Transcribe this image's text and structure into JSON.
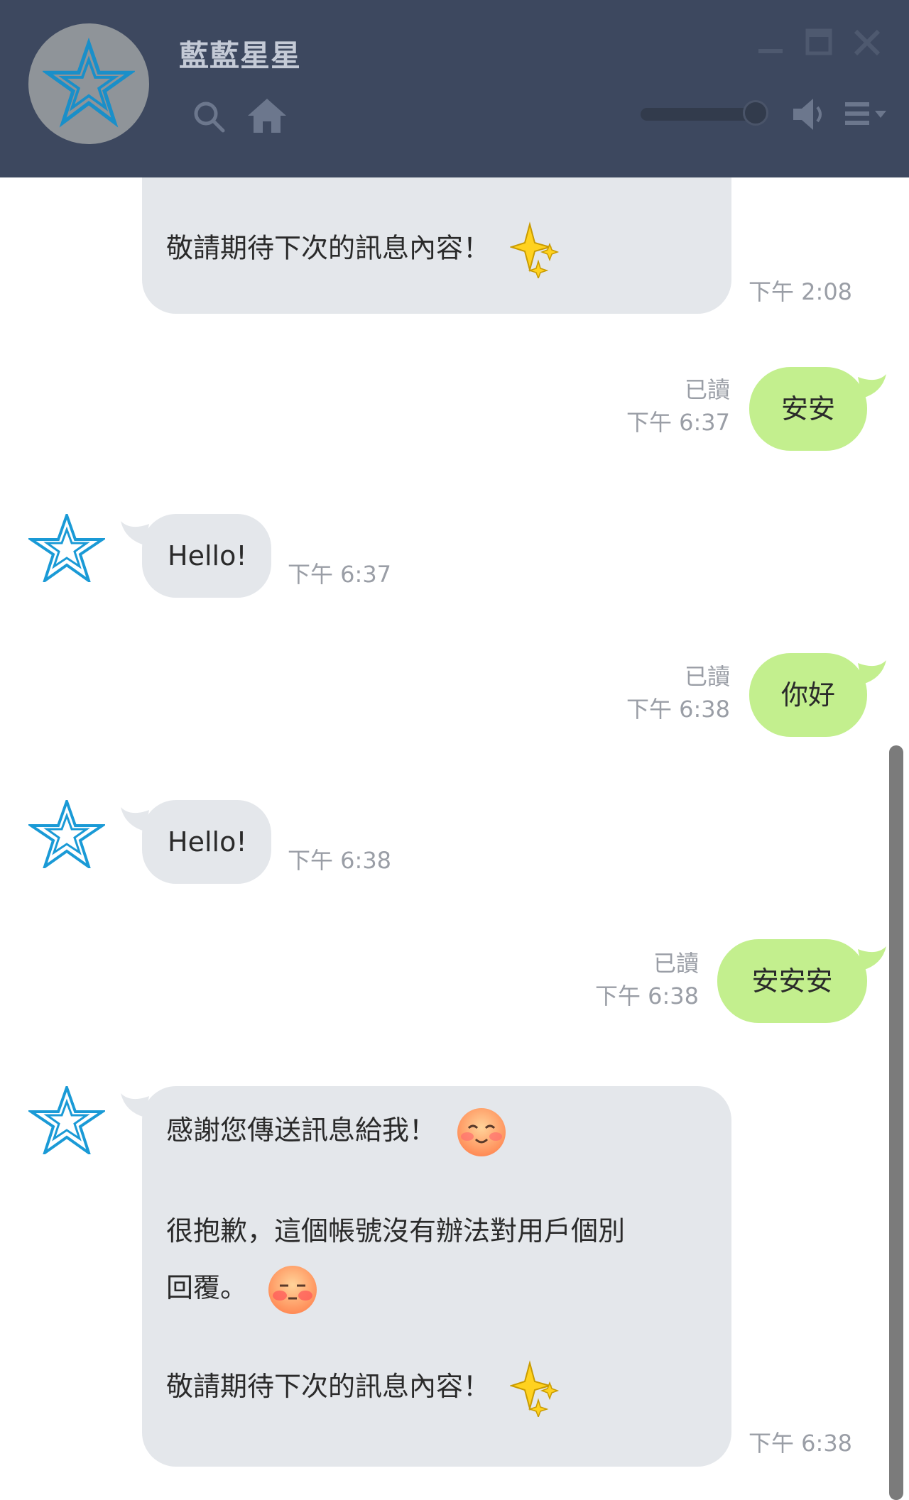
{
  "header": {
    "title": "藍藍星星",
    "colors": {
      "background": "#3d485f",
      "icon": "#6c778d",
      "title": "#c4cad6"
    },
    "icons": [
      "search-icon",
      "home-icon",
      "speaker-icon",
      "menu-icon",
      "minimize-icon",
      "maximize-icon",
      "close-icon",
      "star-avatar-icon"
    ]
  },
  "messages": [
    {
      "side": "in",
      "lines": [
        "敬請期待下次的訊息內容！"
      ],
      "time": "下午 2:08"
    },
    {
      "side": "out",
      "text": "安安",
      "read": "已讀",
      "time": "下午 6:37"
    },
    {
      "side": "in",
      "text": "Hello!",
      "time": "下午 6:37"
    },
    {
      "side": "out",
      "text": "你好",
      "read": "已讀",
      "time": "下午 6:38"
    },
    {
      "side": "in",
      "text": "Hello!",
      "time": "下午 6:38"
    },
    {
      "side": "out",
      "text": "安安安",
      "read": "已讀",
      "time": "下午 6:38"
    },
    {
      "side": "in",
      "line1": "感謝您傳送訊息給我！",
      "line2": "很抱歉，這個帳號沒有辦法對用戶個別",
      "line3": "回覆。",
      "line4": "敬請期待下次的訊息內容！",
      "time": "下午 6:38"
    }
  ],
  "colors": {
    "incoming_bubble": "#e4e7eb",
    "outgoing_bubble": "#c3ef8e",
    "meta_text": "#9a9ea6",
    "star_blue": "#1a9ad6"
  }
}
